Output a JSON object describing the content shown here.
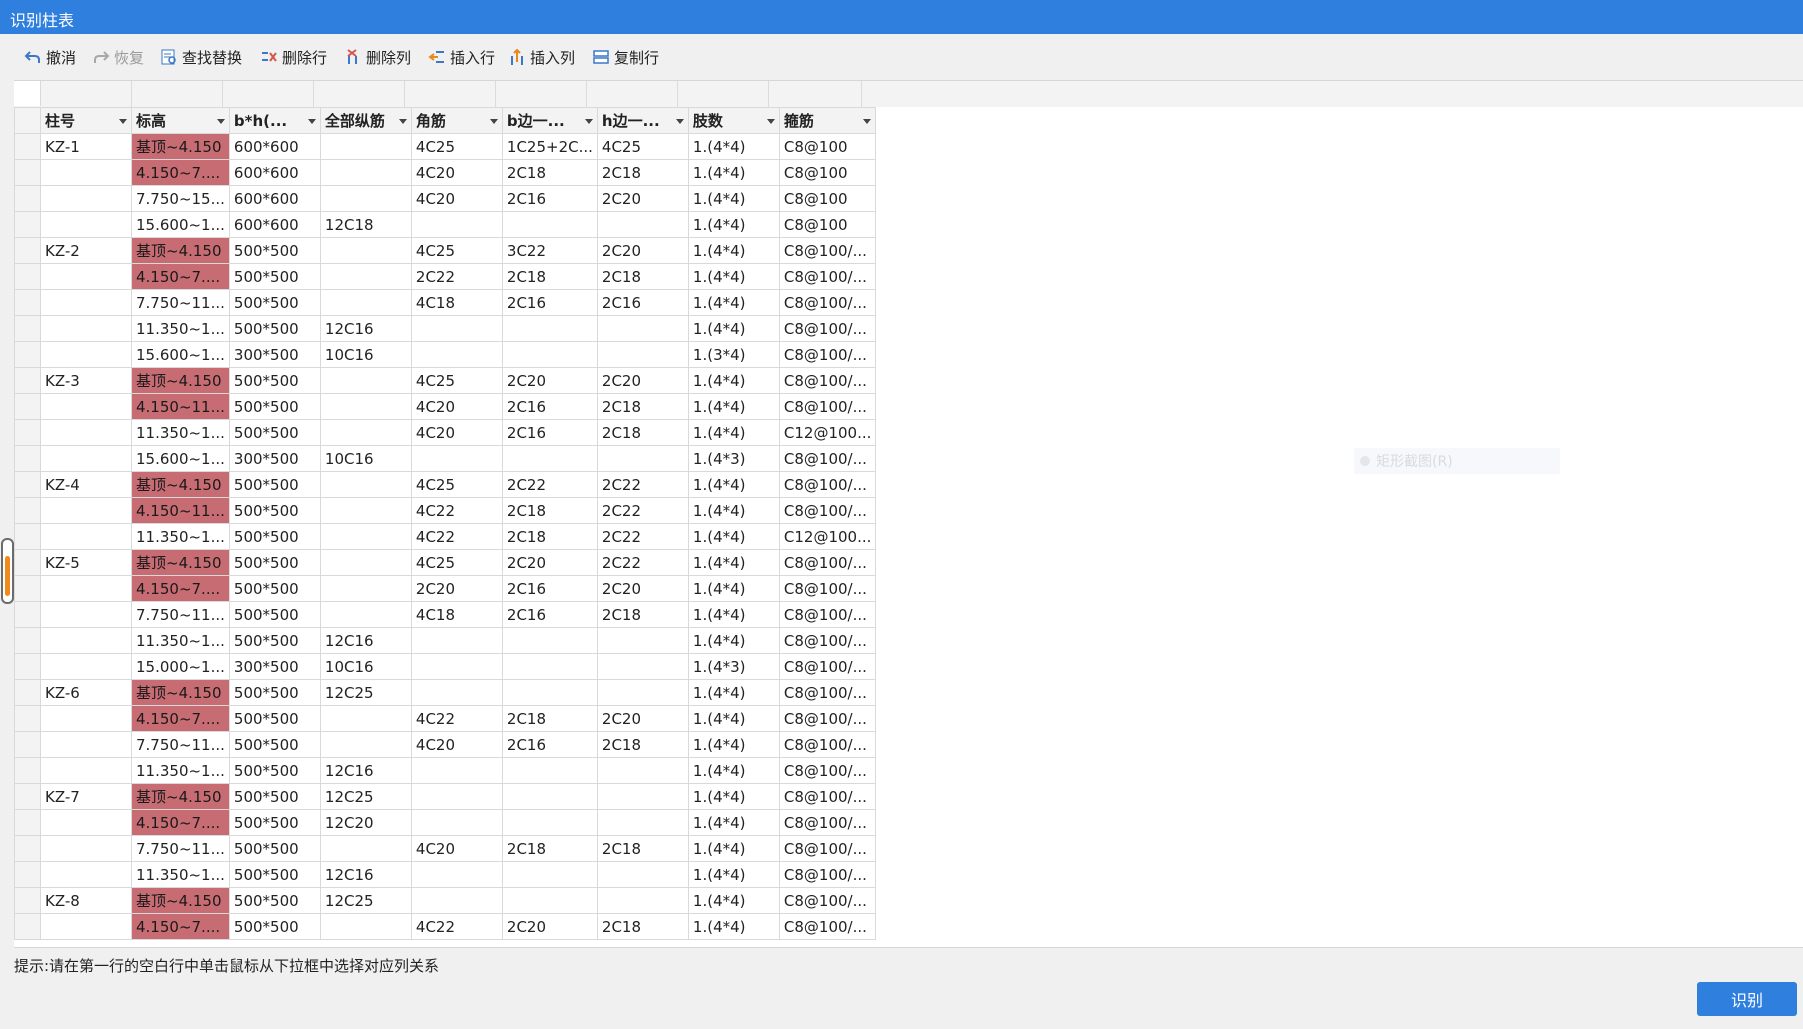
{
  "window": {
    "title": "识别柱表"
  },
  "toolbar": {
    "undo": "撤消",
    "redo": "恢复",
    "find_replace": "查找替换",
    "delete_row": "删除行",
    "delete_col": "删除列",
    "insert_row": "插入行",
    "insert_col": "插入列",
    "copy_row": "复制行"
  },
  "table": {
    "columns": [
      "柱号",
      "标高",
      "b*h(...",
      "全部纵筋",
      "角筋",
      "b边一...",
      "h边一...",
      "肢数",
      "箍筋"
    ],
    "rows": [
      [
        "KZ-1",
        "基顶~4.150",
        "600*600",
        "",
        "4C25",
        "1C25+2C...",
        "4C25",
        "1.(4*4)",
        "C8@100"
      ],
      [
        "",
        "4.150~7....",
        "600*600",
        "",
        "4C20",
        "2C18",
        "2C18",
        "1.(4*4)",
        "C8@100"
      ],
      [
        "",
        "7.750~15...",
        "600*600",
        "",
        "4C20",
        "2C16",
        "2C20",
        "1.(4*4)",
        "C8@100"
      ],
      [
        "",
        "15.600~1...",
        "600*600",
        "12C18",
        "",
        "",
        "",
        "1.(4*4)",
        "C8@100"
      ],
      [
        "KZ-2",
        "基顶~4.150",
        "500*500",
        "",
        "4C25",
        "3C22",
        "2C20",
        "1.(4*4)",
        "C8@100/..."
      ],
      [
        "",
        "4.150~7....",
        "500*500",
        "",
        "2C22",
        "2C18",
        "2C18",
        "1.(4*4)",
        "C8@100/..."
      ],
      [
        "",
        "7.750~11...",
        "500*500",
        "",
        "4C18",
        "2C16",
        "2C16",
        "1.(4*4)",
        "C8@100/..."
      ],
      [
        "",
        "11.350~1...",
        "500*500",
        "12C16",
        "",
        "",
        "",
        "1.(4*4)",
        "C8@100/..."
      ],
      [
        "",
        "15.600~1...",
        "300*500",
        "10C16",
        "",
        "",
        "",
        "1.(3*4)",
        "C8@100/..."
      ],
      [
        "KZ-3",
        "基顶~4.150",
        "500*500",
        "",
        "4C25",
        "2C20",
        "2C20",
        "1.(4*4)",
        "C8@100/..."
      ],
      [
        "",
        "4.150~11...",
        "500*500",
        "",
        "4C20",
        "2C16",
        "2C18",
        "1.(4*4)",
        "C8@100/..."
      ],
      [
        "",
        "11.350~1...",
        "500*500",
        "",
        "4C20",
        "2C16",
        "2C18",
        "1.(4*4)",
        "C12@100..."
      ],
      [
        "",
        "15.600~1...",
        "300*500",
        "10C16",
        "",
        "",
        "",
        "1.(4*3)",
        "C8@100/..."
      ],
      [
        "KZ-4",
        "基顶~4.150",
        "500*500",
        "",
        "4C25",
        "2C22",
        "2C22",
        "1.(4*4)",
        "C8@100/..."
      ],
      [
        "",
        "4.150~11...",
        "500*500",
        "",
        "4C22",
        "2C18",
        "2C22",
        "1.(4*4)",
        "C8@100/..."
      ],
      [
        "",
        "11.350~1...",
        "500*500",
        "",
        "4C22",
        "2C18",
        "2C22",
        "1.(4*4)",
        "C12@100..."
      ],
      [
        "KZ-5",
        "基顶~4.150",
        "500*500",
        "",
        "4C25",
        "2C20",
        "2C22",
        "1.(4*4)",
        "C8@100/..."
      ],
      [
        "",
        "4.150~7....",
        "500*500",
        "",
        "2C20",
        "2C16",
        "2C20",
        "1.(4*4)",
        "C8@100/..."
      ],
      [
        "",
        "7.750~11...",
        "500*500",
        "",
        "4C18",
        "2C16",
        "2C18",
        "1.(4*4)",
        "C8@100/..."
      ],
      [
        "",
        "11.350~1...",
        "500*500",
        "12C16",
        "",
        "",
        "",
        "1.(4*4)",
        "C8@100/..."
      ],
      [
        "",
        "15.000~1...",
        "300*500",
        "10C16",
        "",
        "",
        "",
        "1.(4*3)",
        "C8@100/..."
      ],
      [
        "KZ-6",
        "基顶~4.150",
        "500*500",
        "12C25",
        "",
        "",
        "",
        "1.(4*4)",
        "C8@100/..."
      ],
      [
        "",
        "4.150~7....",
        "500*500",
        "",
        "4C22",
        "2C18",
        "2C20",
        "1.(4*4)",
        "C8@100/..."
      ],
      [
        "",
        "7.750~11...",
        "500*500",
        "",
        "4C20",
        "2C16",
        "2C18",
        "1.(4*4)",
        "C8@100/..."
      ],
      [
        "",
        "11.350~1...",
        "500*500",
        "12C16",
        "",
        "",
        "",
        "1.(4*4)",
        "C8@100/..."
      ],
      [
        "KZ-7",
        "基顶~4.150",
        "500*500",
        "12C25",
        "",
        "",
        "",
        "1.(4*4)",
        "C8@100/..."
      ],
      [
        "",
        "4.150~7....",
        "500*500",
        "12C20",
        "",
        "",
        "",
        "1.(4*4)",
        "C8@100/..."
      ],
      [
        "",
        "7.750~11...",
        "500*500",
        "",
        "4C20",
        "2C18",
        "2C18",
        "1.(4*4)",
        "C8@100/..."
      ],
      [
        "",
        "11.350~1...",
        "500*500",
        "12C16",
        "",
        "",
        "",
        "1.(4*4)",
        "C8@100/..."
      ],
      [
        "KZ-8",
        "基顶~4.150",
        "500*500",
        "12C25",
        "",
        "",
        "",
        "1.(4*4)",
        "C8@100/..."
      ],
      [
        "",
        "4.150~7....",
        "500*500",
        "",
        "4C22",
        "2C20",
        "2C18",
        "1.(4*4)",
        "C8@100/..."
      ]
    ],
    "highlight_color": "#c86c74"
  },
  "context_menu_ghost": {
    "label": "矩形截图(R)"
  },
  "footer": {
    "hint": "提示:请在第一行的空白行中单击鼠标从下拉框中选择对应列关系",
    "recognize_button": "识别"
  },
  "colors": {
    "title_bar": "#2f7fdf",
    "primary_button": "#2f7fdf"
  }
}
